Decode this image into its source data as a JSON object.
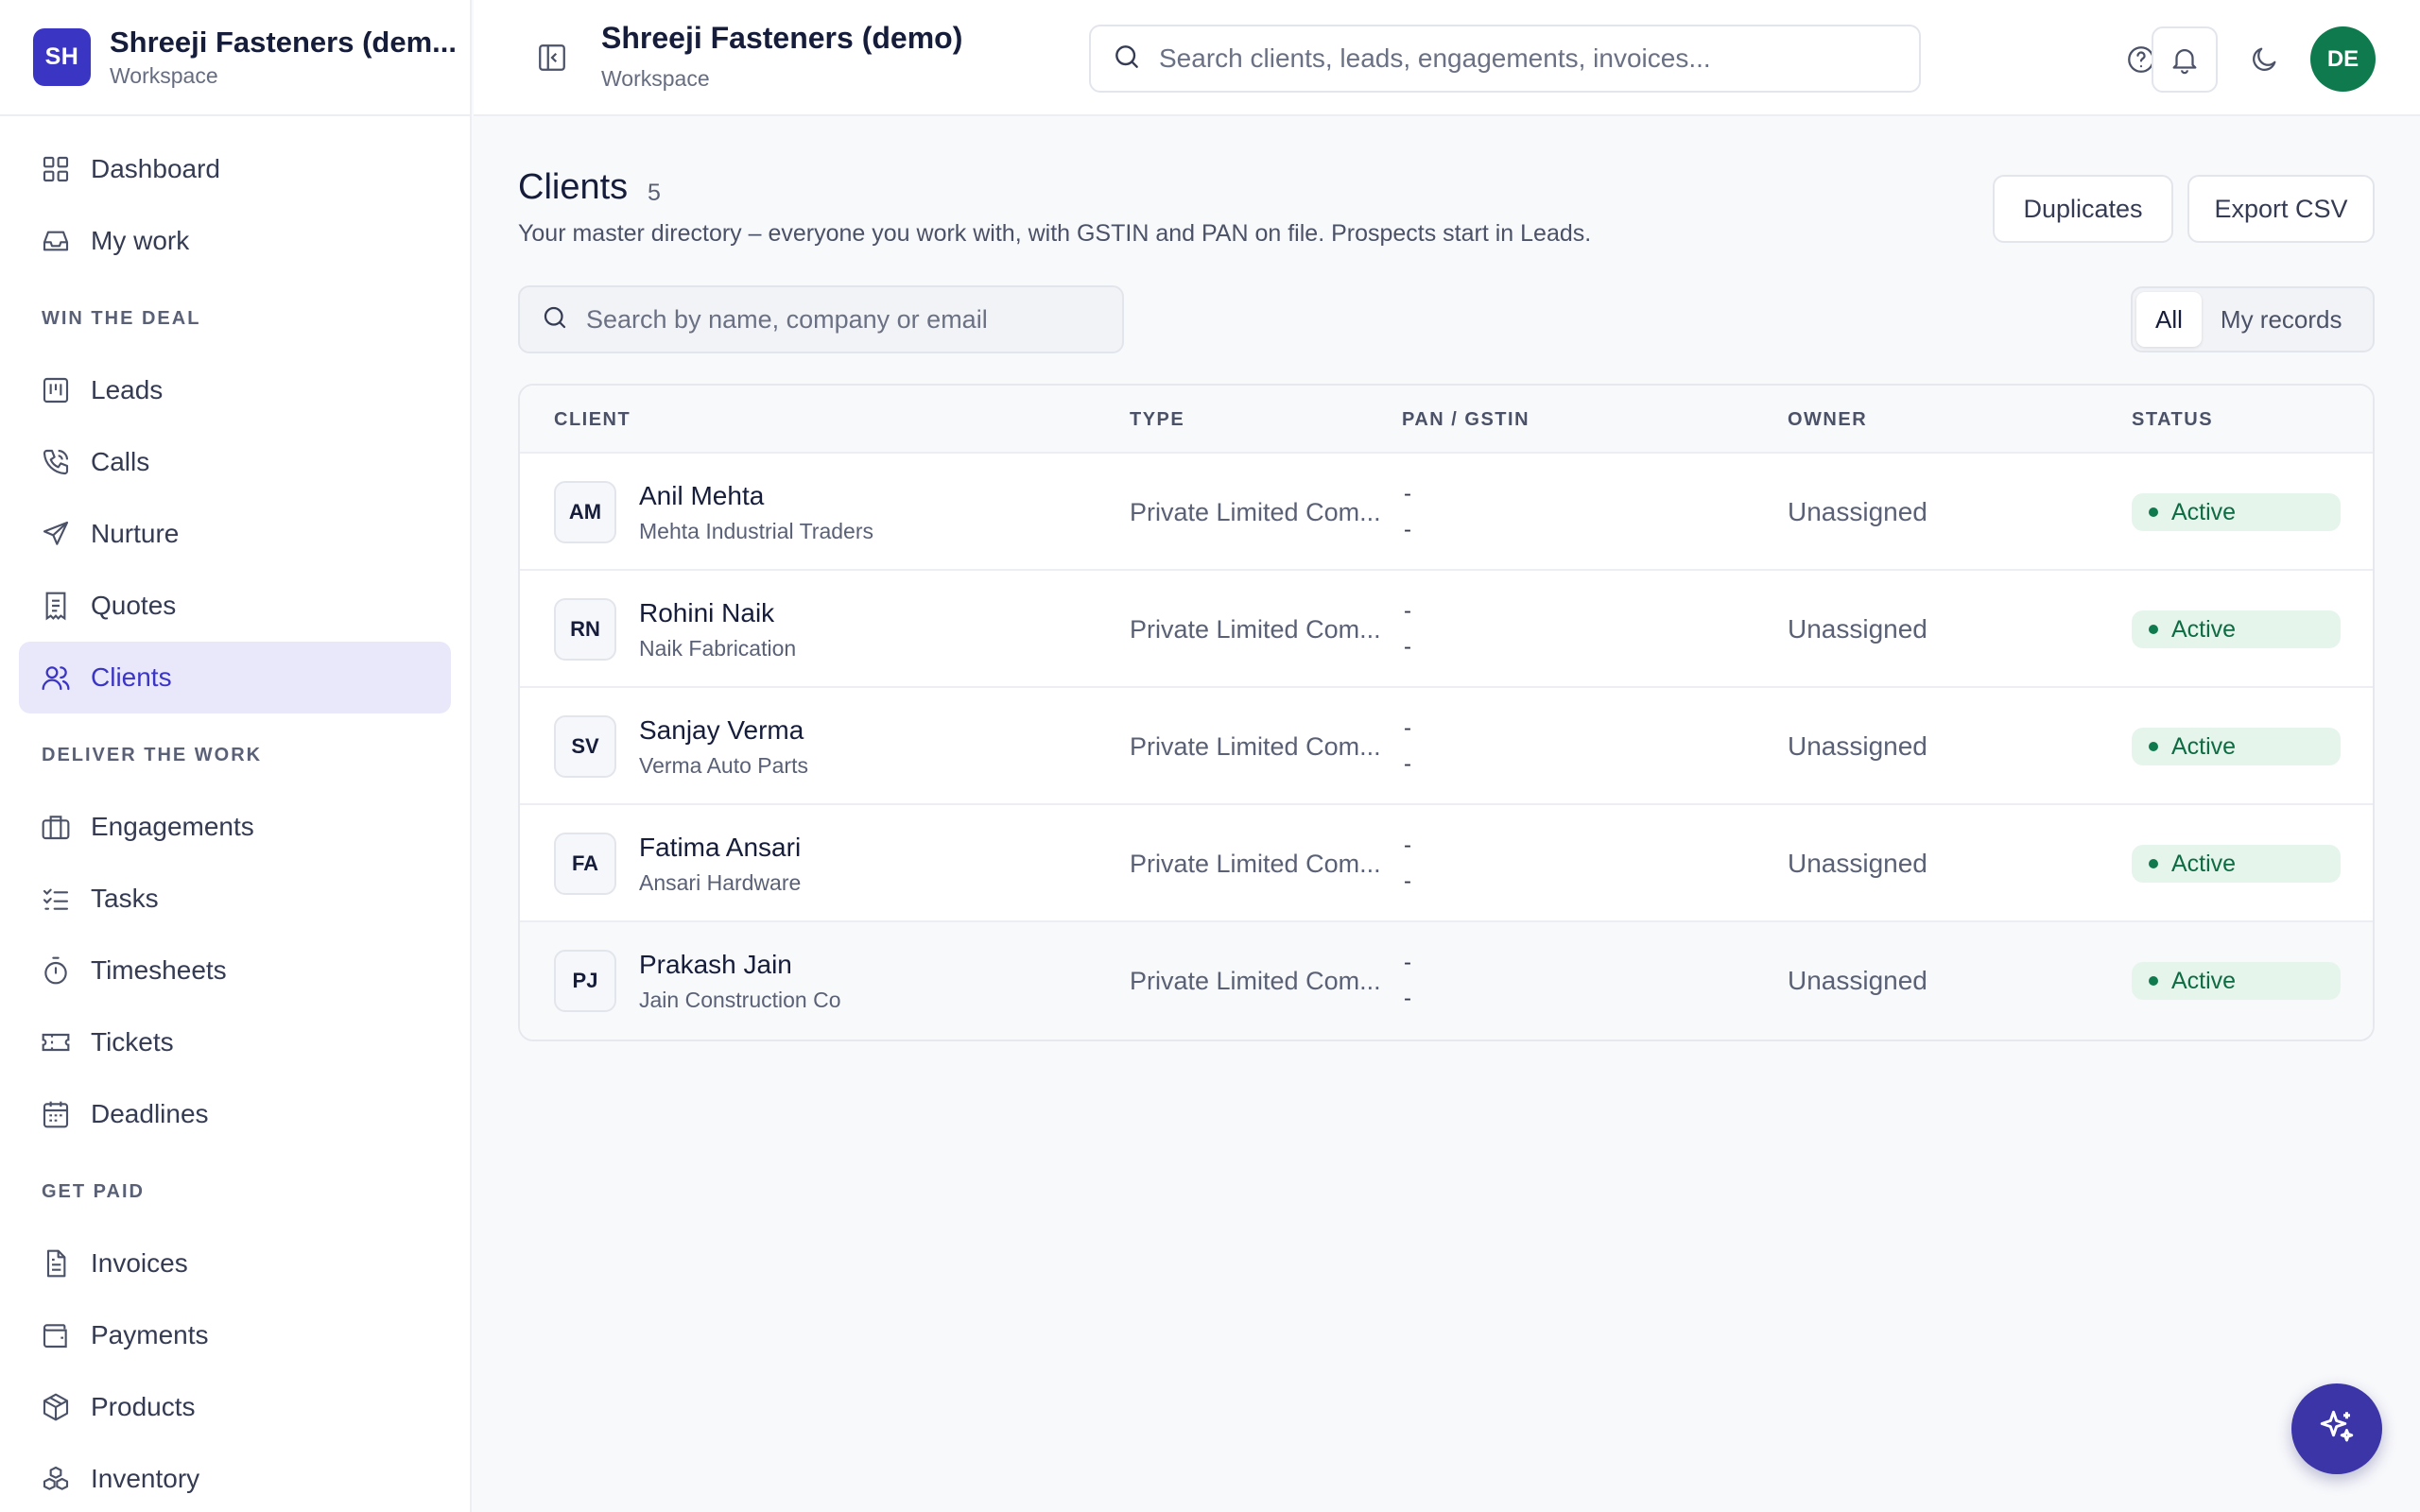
{
  "workspace": {
    "initials": "SH",
    "name": "Shreeji Fasteners (dem...",
    "sub": "Workspace"
  },
  "topbar": {
    "title": "Shreeji Fasteners (demo)",
    "sub": "Workspace",
    "search_placeholder": "Search clients, leads, engagements, invoices...",
    "avatar": "DE"
  },
  "nav": {
    "top": [
      {
        "label": "Dashboard",
        "icon": "grid-icon"
      },
      {
        "label": "My work",
        "icon": "inbox-icon"
      }
    ],
    "sections": [
      {
        "title": "WIN THE DEAL",
        "items": [
          {
            "label": "Leads",
            "icon": "kanban-icon"
          },
          {
            "label": "Calls",
            "icon": "phone-icon"
          },
          {
            "label": "Nurture",
            "icon": "send-icon"
          },
          {
            "label": "Quotes",
            "icon": "receipt-icon"
          },
          {
            "label": "Clients",
            "icon": "users-icon",
            "active": true
          }
        ]
      },
      {
        "title": "DELIVER THE WORK",
        "items": [
          {
            "label": "Engagements",
            "icon": "briefcase-icon"
          },
          {
            "label": "Tasks",
            "icon": "checklist-icon"
          },
          {
            "label": "Timesheets",
            "icon": "timer-icon"
          },
          {
            "label": "Tickets",
            "icon": "ticket-icon"
          },
          {
            "label": "Deadlines",
            "icon": "calendar-icon"
          }
        ]
      },
      {
        "title": "GET PAID",
        "items": [
          {
            "label": "Invoices",
            "icon": "file-icon"
          },
          {
            "label": "Payments",
            "icon": "wallet-icon"
          },
          {
            "label": "Products",
            "icon": "box-icon"
          },
          {
            "label": "Inventory",
            "icon": "boxes-icon"
          }
        ]
      }
    ]
  },
  "page": {
    "title": "Clients",
    "count": "5",
    "description": "Your master directory – everyone you work with, with GSTIN and PAN on file. Prospects start in Leads.",
    "duplicates_label": "Duplicates",
    "export_label": "Export CSV",
    "search_placeholder": "Search by name, company or email",
    "filter": {
      "all": "All",
      "mine": "My records"
    }
  },
  "table": {
    "headers": {
      "client": "CLIENT",
      "type": "TYPE",
      "pan": "PAN / GSTIN",
      "owner": "OWNER",
      "status": "STATUS"
    },
    "rows": [
      {
        "initials": "AM",
        "name": "Anil Mehta",
        "company": "Mehta Industrial Traders",
        "type": "Private Limited Com...",
        "pan": "-",
        "gstin": "-",
        "owner": "Unassigned",
        "status": "Active"
      },
      {
        "initials": "RN",
        "name": "Rohini Naik",
        "company": "Naik Fabrication",
        "type": "Private Limited Com...",
        "pan": "-",
        "gstin": "-",
        "owner": "Unassigned",
        "status": "Active"
      },
      {
        "initials": "SV",
        "name": "Sanjay Verma",
        "company": "Verma Auto Parts",
        "type": "Private Limited Com...",
        "pan": "-",
        "gstin": "-",
        "owner": "Unassigned",
        "status": "Active"
      },
      {
        "initials": "FA",
        "name": "Fatima Ansari",
        "company": "Ansari Hardware",
        "type": "Private Limited Com...",
        "pan": "-",
        "gstin": "-",
        "owner": "Unassigned",
        "status": "Active"
      },
      {
        "initials": "PJ",
        "name": "Prakash Jain",
        "company": "Jain Construction Co",
        "type": "Private Limited Com...",
        "pan": "-",
        "gstin": "-",
        "owner": "Unassigned",
        "status": "Active"
      }
    ]
  },
  "colors": {
    "accent": "#3b35c4",
    "active_bg": "#e9e8fb",
    "status_green": "#0f7a4d",
    "avatar_green": "#0f7a4d"
  }
}
